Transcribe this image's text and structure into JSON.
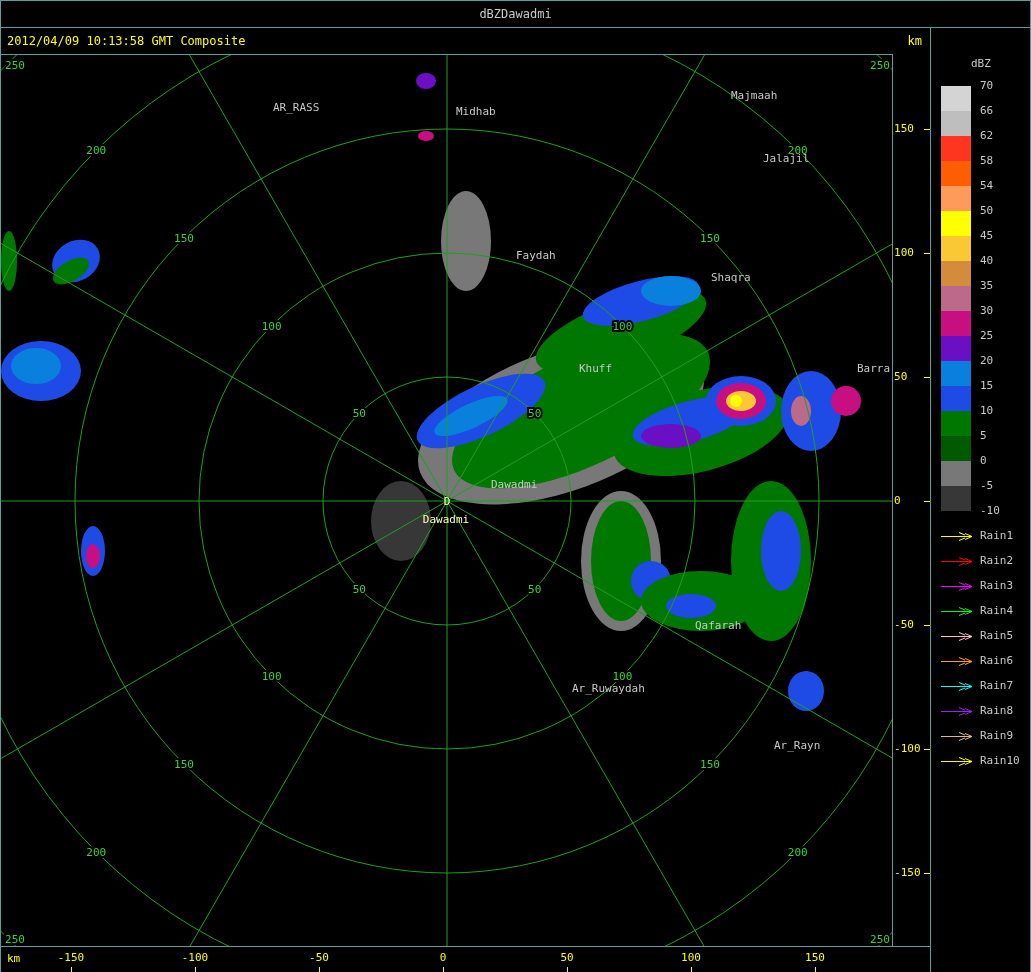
{
  "window": {
    "title": "dBZDawadmi"
  },
  "header": {
    "timestamp": "2012/04/09 10:13:58 GMT Composite",
    "unit": "km"
  },
  "radar": {
    "rings": [
      {
        "labels": [
          "50",
          "50",
          "50",
          "50"
        ]
      },
      {
        "labels": [
          "100",
          "100",
          "100",
          "100"
        ]
      },
      {
        "labels": [
          "150",
          "150",
          "150",
          "150"
        ]
      },
      {
        "labels": [
          "200",
          "200",
          "200",
          "200"
        ]
      },
      {
        "labels": [
          "250",
          "250",
          "250",
          "250"
        ]
      }
    ],
    "places": [
      "AR_RASS",
      "Midhab",
      "Majmaah",
      "Jalajil",
      "Faydah",
      "Shaqra",
      "Khuff",
      "Barra",
      "Dawadmi",
      "Qafarah",
      "Ar_Ruwaydah",
      "Ar_Rayn"
    ],
    "site": {
      "marker": "D",
      "name": "Dawadmi"
    }
  },
  "y_axis": {
    "ticks": [
      "150",
      "100",
      "50",
      "0",
      "-50",
      "-100",
      "-150"
    ]
  },
  "x_axis": {
    "unit": "km",
    "ticks": [
      "-150",
      "-100",
      "-50",
      "0",
      "50",
      "100",
      "150"
    ]
  },
  "legend": {
    "title": "dBZ",
    "swatches": [
      {
        "color": "#d4d4d4"
      },
      {
        "color": "#bebebe"
      },
      {
        "color": "#ff3520"
      },
      {
        "color": "#ff5e00"
      },
      {
        "color": "#ff9b5a"
      },
      {
        "color": "#ffff00"
      },
      {
        "color": "#fac832"
      },
      {
        "color": "#d28c3c"
      },
      {
        "color": "#bc6a8a"
      },
      {
        "color": "#c80f82"
      },
      {
        "color": "#6a0fc4"
      },
      {
        "color": "#0880dc"
      },
      {
        "color": "#1e4be6"
      },
      {
        "color": "#007800"
      },
      {
        "color": "#005a00"
      },
      {
        "color": "#787878"
      },
      {
        "color": "#373737"
      }
    ],
    "levels": [
      "70",
      "66",
      "62",
      "58",
      "54",
      "50",
      "45",
      "40",
      "35",
      "30",
      "25",
      "20",
      "15",
      "10",
      "5",
      "0",
      "-5",
      "-10"
    ],
    "tracks": [
      {
        "label": "Rain1",
        "color": "#ffff00"
      },
      {
        "label": "Rain2",
        "color": "#ff0000"
      },
      {
        "label": "Rain3",
        "color": "#ff00ff"
      },
      {
        "label": "Rain4",
        "color": "#00ff00"
      },
      {
        "label": "Rain5",
        "color": "#ffc0cb"
      },
      {
        "label": "Rain6",
        "color": "#ffa500"
      },
      {
        "label": "Rain7",
        "color": "#00ffff"
      },
      {
        "label": "Rain8",
        "color": "#a020f0"
      },
      {
        "label": "Rain9",
        "color": "#deb887"
      },
      {
        "label": "Rain10",
        "color": "#ffff00"
      }
    ]
  }
}
